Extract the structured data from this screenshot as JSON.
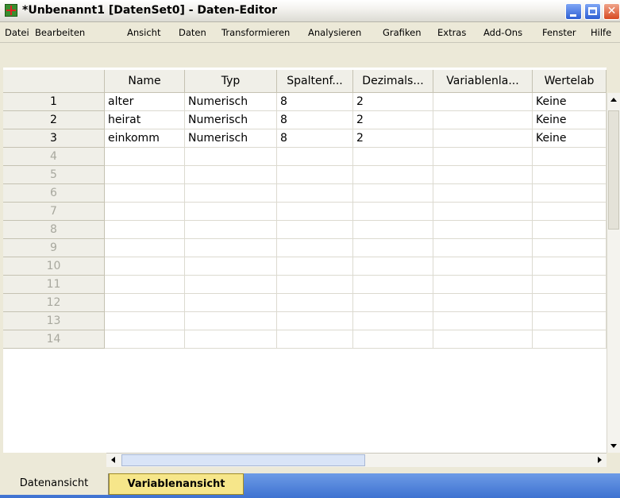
{
  "window": {
    "title": "*Unbenannt1 [DatenSet0] - Daten-Editor",
    "minimize_label": "",
    "maximize_label": "",
    "close_label": "✕"
  },
  "menu": [
    "Datei",
    "Bearbeiten",
    "Ansicht",
    "Daten",
    "Transformieren",
    "Analysieren",
    "Grafiken",
    "Extras",
    "Add-Ons",
    "Fenster",
    "Hilfe"
  ],
  "grid": {
    "columns": [
      "Name",
      "Typ",
      "Spaltenf...",
      "Dezimals...",
      "Variablenla...",
      "Wertelab"
    ],
    "row_numbers": [
      "1",
      "2",
      "3",
      "4",
      "5",
      "6",
      "7",
      "8",
      "9",
      "10",
      "11",
      "12",
      "13",
      "14"
    ],
    "rows": [
      [
        "alter",
        "Numerisch",
        "8",
        "2",
        "",
        "Keine"
      ],
      [
        "heirat",
        "Numerisch",
        "8",
        "2",
        "",
        "Keine"
      ],
      [
        "einkomm",
        "Numerisch",
        "8",
        "2",
        "",
        "Keine"
      ]
    ]
  },
  "tabs": {
    "data_view": "Datenansicht",
    "variable_view": "Variablenansicht",
    "active": "variable_view"
  },
  "colors": {
    "active_tab": "#f6e68a",
    "tabbar": "#3e72d1",
    "title_close": "#d74a22"
  },
  "icons": [
    "app-icon",
    "minimize-icon",
    "maximize-icon",
    "close-icon",
    "scroll-up-icon",
    "scroll-down-icon",
    "scroll-left-icon",
    "scroll-right-icon"
  ]
}
